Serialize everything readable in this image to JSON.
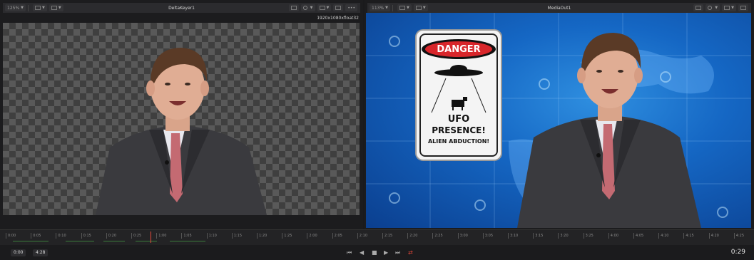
{
  "left_viewer": {
    "zoom": "125%",
    "title": "DeltaKeyer1",
    "resolution": "1920x1080xfloat32",
    "more": "•••"
  },
  "right_viewer": {
    "zoom": "113%",
    "title": "MediaOut1"
  },
  "sign": {
    "header": "DANGER",
    "line1": "UFO",
    "line2": "PRESENCE!",
    "line3": "ALIEN ABDUCTION!"
  },
  "timeline_ticks": [
    "0:00",
    "0:05",
    "0:10",
    "0:15",
    "0:20",
    "0:25",
    "1:00",
    "1:05",
    "1:10",
    "1:15",
    "1:20",
    "1:25",
    "2:00",
    "2:05",
    "2:10",
    "2:15",
    "2:20",
    "2:25",
    "3:00",
    "3:05",
    "3:10",
    "3:15",
    "3:20",
    "3:25",
    "4:00",
    "4:05",
    "4:10",
    "4:15",
    "4:20",
    "4:25"
  ],
  "transport": {
    "start_time": "0:00",
    "end_time": "4:28",
    "current_time": "0:29",
    "loop_color": "#e8483a"
  },
  "icons": {
    "go_to_start": "skip-to-start-icon",
    "step_back": "step-back-icon",
    "stop": "stop-icon",
    "play": "play-icon",
    "go_to_end": "skip-to-end-icon",
    "loop": "loop-icon"
  }
}
